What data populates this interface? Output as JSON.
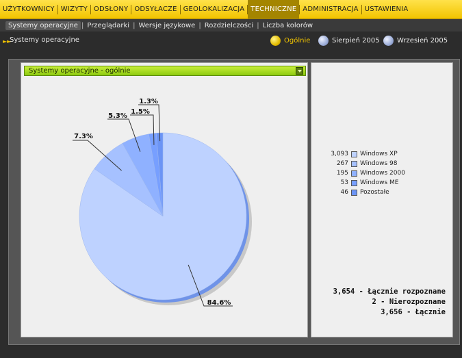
{
  "top_nav": [
    {
      "label": "UŻYTKOWNICY",
      "active": false
    },
    {
      "label": "WIZYTY",
      "active": false
    },
    {
      "label": "ODSŁONY",
      "active": false
    },
    {
      "label": "ODSYŁACZE",
      "active": false
    },
    {
      "label": "GEOLOKALIZACJA",
      "active": false
    },
    {
      "label": "TECHNICZNE",
      "active": true
    },
    {
      "label": "ADMINISTRACJA",
      "active": false
    },
    {
      "label": "USTAWIENIA",
      "active": false
    }
  ],
  "sub_nav": [
    {
      "label": "Systemy operacyjne",
      "active": true
    },
    {
      "label": "Przeglądarki",
      "active": false
    },
    {
      "label": "Wersje językowe",
      "active": false
    },
    {
      "label": "Rozdzielczości",
      "active": false
    },
    {
      "label": "Liczba kolorów",
      "active": false
    }
  ],
  "breadcrumb": "Systemy operacyjne",
  "periods": [
    {
      "label": "Ogólnie",
      "active": true,
      "icon": "yellow-dot-icon"
    },
    {
      "label": "Sierpień 2005",
      "active": false,
      "icon": "blue-dot-icon"
    },
    {
      "label": "Wrzesień 2005",
      "active": false,
      "icon": "blue-dot-icon"
    }
  ],
  "chart_header": "Systemy operacyjne - ogólnie",
  "chart_data": {
    "type": "pie",
    "title": "Systemy operacyjne - ogólnie",
    "categories": [
      "Windows XP",
      "Windows 98",
      "Windows 2000",
      "Windows ME",
      "Pozostałe"
    ],
    "values": [
      3093,
      267,
      195,
      53,
      46
    ],
    "percent_labels": [
      "84.6%",
      "7.3%",
      "5.3%",
      "1.5%",
      "1.3%"
    ],
    "colors": [
      "#bed2ff",
      "#a6c1ff",
      "#8fb1ff",
      "#779fff",
      "#6b94f5"
    ],
    "legend_position": "right"
  },
  "totals": [
    {
      "value": "3,654",
      "label": "Łącznie rozpoznane"
    },
    {
      "value": "2",
      "label": "Nierozpoznane"
    },
    {
      "value": "3,656",
      "label": "Łącznie"
    }
  ]
}
